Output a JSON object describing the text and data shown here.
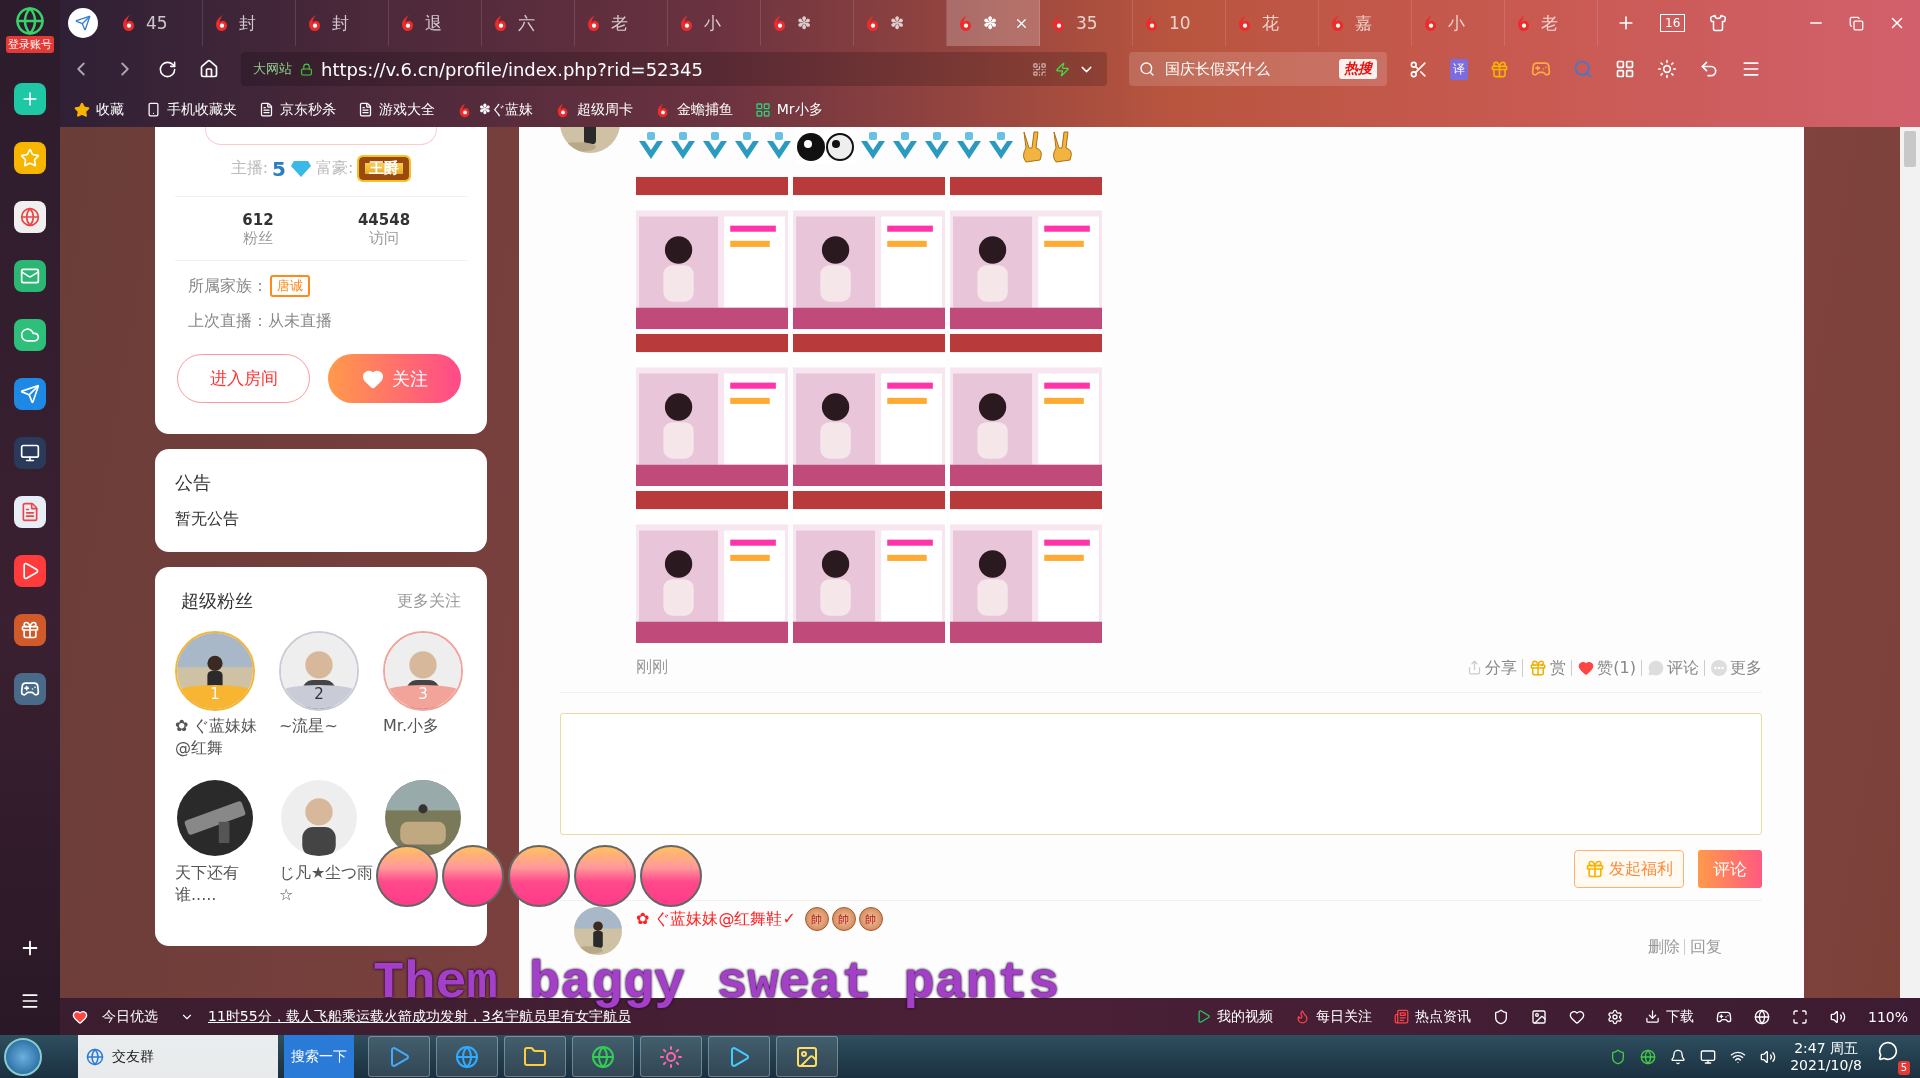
{
  "sidebar": {
    "account_label": "登录账号"
  },
  "tabs": [
    {
      "label": "45",
      "selected": false
    },
    {
      "label": "封",
      "selected": false
    },
    {
      "label": "封",
      "selected": false
    },
    {
      "label": "退",
      "selected": false
    },
    {
      "label": "六",
      "selected": false
    },
    {
      "label": "老",
      "selected": false
    },
    {
      "label": "小",
      "selected": false
    },
    {
      "label": "✽",
      "selected": false
    },
    {
      "label": "✽",
      "selected": false
    },
    {
      "label": "✽",
      "selected": true
    },
    {
      "label": "35",
      "selected": false
    },
    {
      "label": "10",
      "selected": false
    },
    {
      "label": "花",
      "selected": false
    },
    {
      "label": "嘉",
      "selected": false
    },
    {
      "label": "小",
      "selected": false
    },
    {
      "label": "老",
      "selected": false
    }
  ],
  "tab_count": "16",
  "address": {
    "site_label": "大网站",
    "url": "https://v.6.cn/profile/index.php?rid=52345"
  },
  "search": {
    "placeholder": "国庆长假买什么",
    "hot_label": "热搜"
  },
  "translate_label": "译",
  "bookmarks": [
    {
      "label": "收藏",
      "kind": "star"
    },
    {
      "label": "手机收藏夹",
      "kind": "phone"
    },
    {
      "label": "京东秒杀",
      "kind": "page"
    },
    {
      "label": "游戏大全",
      "kind": "page"
    },
    {
      "label": "✽ぐ蓝妹",
      "kind": "six"
    },
    {
      "label": "超级周卡",
      "kind": "six"
    },
    {
      "label": "金蟾捕鱼",
      "kind": "six"
    },
    {
      "label": "Mr小多",
      "kind": "app"
    }
  ],
  "profile": {
    "anchor_label": "主播:",
    "anchor_level": "5",
    "rich_label": "富豪:",
    "rich_badge": "王爵",
    "stats": [
      {
        "value": "612",
        "label": "粉丝"
      },
      {
        "value": "44548",
        "label": "访问"
      }
    ],
    "family_label": "所属家族：",
    "family_badge": "唐诚",
    "last_live": "上次直播：从未直播",
    "enter_button": "进入房间",
    "follow_button": "关注"
  },
  "notice": {
    "title": "公告",
    "body": "暂无公告"
  },
  "super_fans": {
    "title": "超级粉丝",
    "more": "更多关注",
    "fans": [
      {
        "kind": "ranked",
        "name": "✿ ぐ蓝妹妹@红舞",
        "rank": "1",
        "color": "#f7b531"
      },
      {
        "kind": "ranked",
        "name": "~流星~",
        "rank": "2",
        "color": "#c9ccd6"
      },
      {
        "kind": "ranked",
        "name": "Mr.小多",
        "rank": "3",
        "color": "#f2a39a"
      },
      {
        "kind": "plain",
        "name": "天下还有谁....."
      },
      {
        "kind": "plain",
        "name": "じ凡★尘つ雨☆"
      },
      {
        "kind": "plain"
      }
    ]
  },
  "post": {
    "time": "刚刚",
    "actions": [
      {
        "label": "分享",
        "kind": "share"
      },
      {
        "label": "赏",
        "kind": "reward"
      },
      {
        "label": "赞(1)",
        "kind": "like"
      },
      {
        "label": "评论",
        "kind": "comment"
      },
      {
        "label": "更多",
        "kind": "more"
      }
    ]
  },
  "comment_box": {
    "welfare_button": "发起福利",
    "submit_button": "评论"
  },
  "comments": [
    {
      "name": "✿ ぐ蓝妹妹@红舞鞋✓",
      "badges": [
        "帥",
        "帥",
        "帥"
      ],
      "actions": [
        "删除",
        "回复"
      ]
    }
  ],
  "overlay": {
    "caption": "Them baggy sweat pants",
    "bubbles": [
      {
        "kind": "bubble"
      },
      {
        "kind": "bubble"
      },
      {
        "kind": "bubble"
      },
      {
        "kind": "bubble"
      },
      {
        "kind": "bubble"
      }
    ]
  },
  "status_bar": {
    "left_label": "今日优选",
    "news": "11时55分，载人飞船乘运载火箭成功发射，3名宇航员里有女宇航员",
    "links": [
      {
        "label": "我的视频",
        "kind": "video"
      },
      {
        "label": "每日关注",
        "kind": "fire"
      },
      {
        "label": "热点资讯",
        "kind": "news"
      }
    ],
    "download": "下载",
    "zoom": "110%"
  },
  "taskbar": {
    "search_value": "交友群",
    "search_button": "搜索一下",
    "time": "2:47 周五",
    "date": "2021/10/8",
    "notification_count": "5"
  }
}
